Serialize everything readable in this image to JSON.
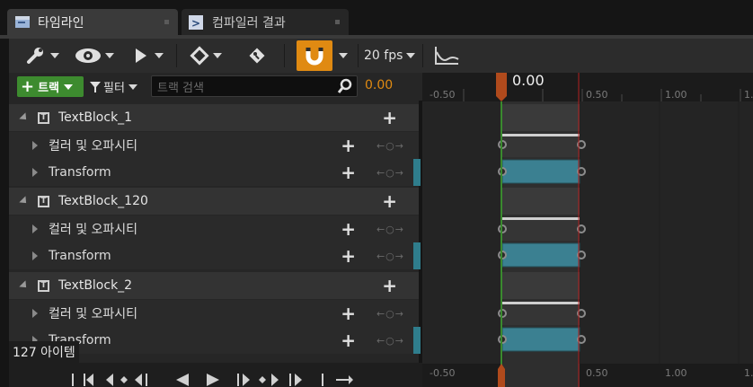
{
  "tabs": [
    {
      "label": "타임라인",
      "active": true
    },
    {
      "label": "컴파일러 결과",
      "active": false
    }
  ],
  "toolbar": {
    "fps": "20 fps",
    "snap_color": "#e08a12"
  },
  "filterbar": {
    "add_track": "트랙",
    "filter": "필터",
    "search_placeholder": "트랙 검색",
    "current_time": "0.00"
  },
  "outliner": [
    {
      "name": "TextBlock_1",
      "tracks": [
        "컬러 및 오파시티",
        "Transform"
      ]
    },
    {
      "name": "TextBlock_120",
      "tracks": [
        "컬러 및 오파시티",
        "Transform"
      ]
    },
    {
      "name": "TextBlock_2",
      "tracks": [
        "컬러 및 오파시티",
        "Transform"
      ]
    }
  ],
  "item_count": "127 아이템",
  "timeline": {
    "current_time_label": "0.00",
    "ticks": [
      "-0.50",
      "0.50",
      "1.00",
      "1.50"
    ],
    "playhead_color": "#b04a1c",
    "track_color": "#3b8091"
  }
}
